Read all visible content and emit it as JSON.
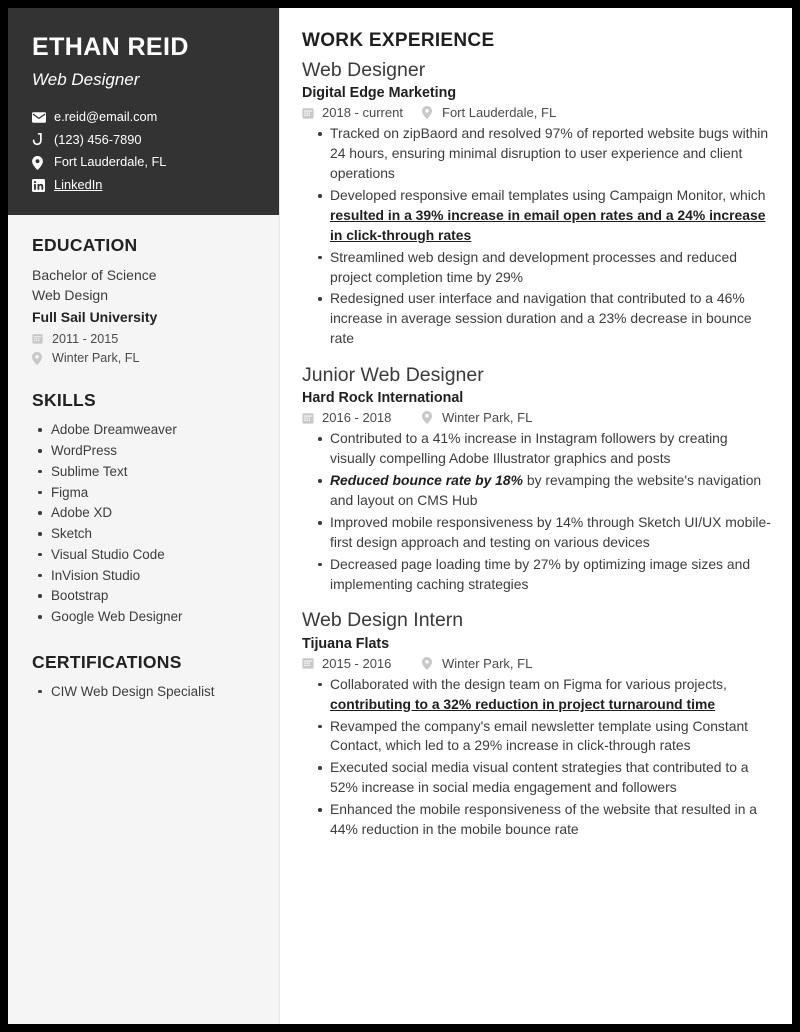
{
  "colors": {
    "header_bg": "#333333",
    "sidebar_bg": "#f5f5f5",
    "page_bg": "#ffffff",
    "text_dark": "#1f1f1f",
    "text_body": "#3c3c3c",
    "icon_gray": "#c8c8c8"
  },
  "header": {
    "name": "ETHAN REID",
    "role": "Web Designer",
    "contacts": [
      {
        "icon": "envelope-icon",
        "text": "e.reid@email.com",
        "link": false
      },
      {
        "icon": "phone-icon",
        "text": "(123) 456-7890",
        "link": false
      },
      {
        "icon": "map-pin-icon",
        "text": "Fort Lauderdale, FL",
        "link": false
      },
      {
        "icon": "linkedin-icon",
        "text": "LinkedIn",
        "link": true
      }
    ]
  },
  "education": {
    "heading": "EDUCATION",
    "degree_line1": "Bachelor of Science",
    "degree_line2": "Web Design",
    "school": "Full Sail University",
    "dates": "2011 - 2015",
    "location": "Winter Park, FL"
  },
  "skills": {
    "heading": "SKILLS",
    "items": [
      "Adobe Dreamweaver",
      "WordPress",
      "Sublime Text",
      "Figma",
      "Adobe XD",
      "Sketch",
      "Visual Studio Code",
      "InVision Studio",
      "Bootstrap",
      "Google Web Designer"
    ]
  },
  "certifications": {
    "heading": "CERTIFICATIONS",
    "items": [
      "CIW Web Design Specialist"
    ]
  },
  "work": {
    "heading": "WORK EXPERIENCE",
    "jobs": [
      {
        "title": "Web Designer",
        "company": "Digital Edge Marketing",
        "dates": "2018 - current",
        "location": "Fort Lauderdale, FL",
        "bullets": [
          {
            "parts": [
              {
                "text": "Tracked on zipBaord and resolved 97% of reported website bugs within 24 hours, ensuring minimal disruption to user experience and client operations",
                "style": "normal"
              }
            ]
          },
          {
            "parts": [
              {
                "text": "Developed responsive email templates using Campaign Monitor, which ",
                "style": "normal"
              },
              {
                "text": "resulted in a 39% increase in email open rates and a 24% increase in click-through rates",
                "style": "bold-underline"
              }
            ]
          },
          {
            "parts": [
              {
                "text": "Streamlined web design and development processes and reduced project completion time by 29%",
                "style": "normal"
              }
            ]
          },
          {
            "parts": [
              {
                "text": "Redesigned user interface and navigation that contributed to a 46% increase in average session duration and a 23% decrease in bounce rate",
                "style": "normal"
              }
            ]
          }
        ]
      },
      {
        "title": "Junior Web Designer",
        "company": "Hard Rock International",
        "dates": "2016 - 2018",
        "location": "Winter Park, FL",
        "bullets": [
          {
            "parts": [
              {
                "text": "Contributed to a 41% increase in Instagram followers by creating visually compelling Adobe Illustrator graphics and posts",
                "style": "normal"
              }
            ]
          },
          {
            "parts": [
              {
                "text": "Reduced bounce rate by 18%",
                "style": "bold-italic"
              },
              {
                "text": " by revamping the website's navigation and layout on CMS Hub",
                "style": "normal"
              }
            ]
          },
          {
            "parts": [
              {
                "text": "Improved mobile responsiveness by 14% through Sketch UI/UX mobile-first design approach and testing on various devices",
                "style": "normal"
              }
            ]
          },
          {
            "parts": [
              {
                "text": "Decreased page loading time by 27% by optimizing image sizes and implementing caching strategies",
                "style": "normal"
              }
            ]
          }
        ]
      },
      {
        "title": "Web Design Intern",
        "company": "Tijuana Flats",
        "dates": "2015 - 2016",
        "location": "Winter Park, FL",
        "bullets": [
          {
            "parts": [
              {
                "text": "Collaborated with the design team on Figma for various projects, ",
                "style": "normal"
              },
              {
                "text": "contributing to a 32% reduction in project turnaround time",
                "style": "bold-underline"
              }
            ]
          },
          {
            "parts": [
              {
                "text": "Revamped the company's email newsletter template using Constant Contact, which led to a 29% increase in click-through rates",
                "style": "normal"
              }
            ]
          },
          {
            "parts": [
              {
                "text": "Executed social media visual content strategies that contributed to a 52% increase in social media engagement and followers",
                "style": "normal"
              }
            ]
          },
          {
            "parts": [
              {
                "text": "Enhanced the mobile responsiveness of the website that resulted in a 44% reduction in the mobile bounce rate",
                "style": "normal"
              }
            ]
          }
        ]
      }
    ]
  }
}
